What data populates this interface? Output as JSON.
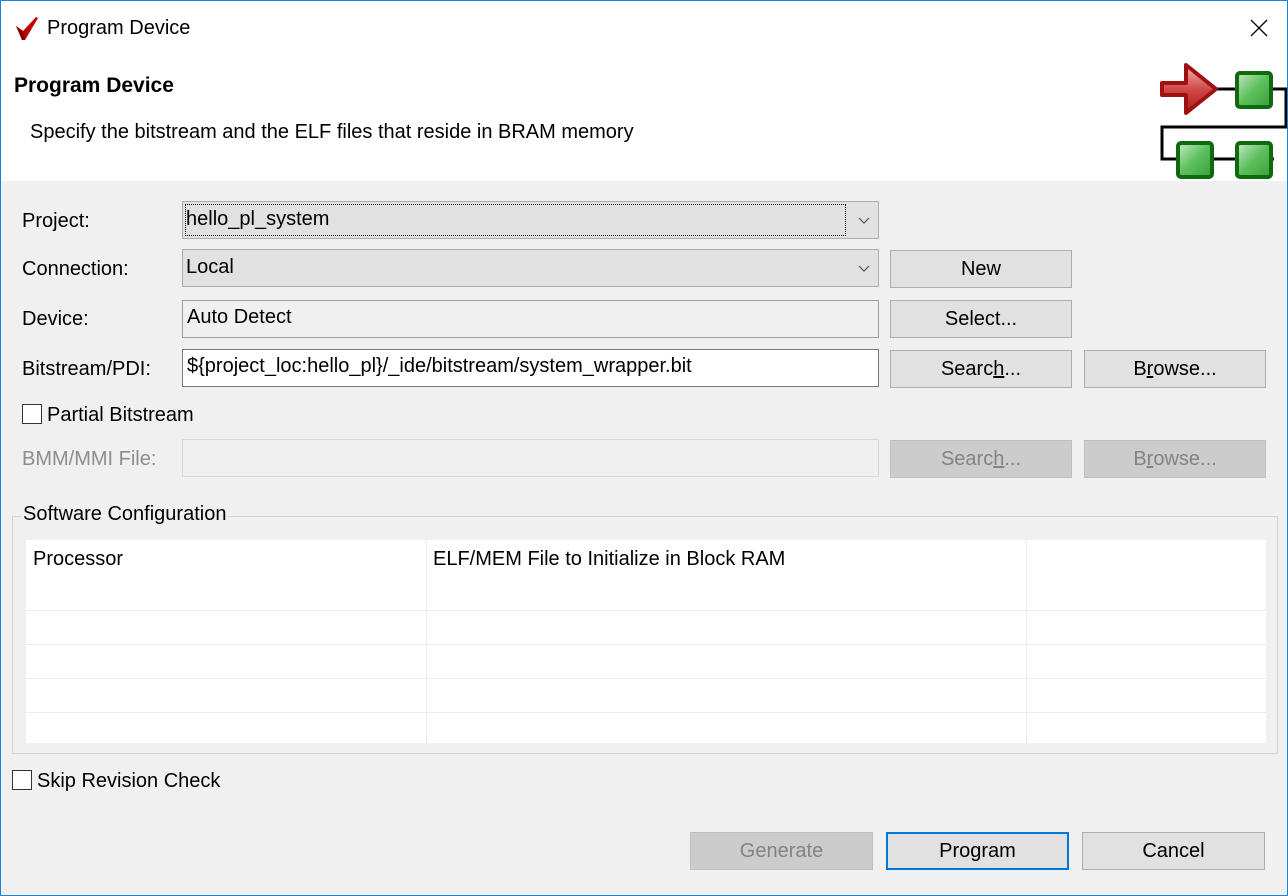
{
  "window": {
    "title": "Program Device"
  },
  "banner": {
    "title": "Program Device",
    "description": "Specify the bitstream and the ELF files that reside in BRAM memory"
  },
  "form": {
    "project": {
      "label": "Project:",
      "value": "hello_pl_system"
    },
    "connection": {
      "label": "Connection:",
      "value": "Local",
      "new_button": "New"
    },
    "device": {
      "label": "Device:",
      "value": "Auto Detect",
      "select_button": "Select..."
    },
    "bitstream": {
      "label": "Bitstream/PDI:",
      "value": "${project_loc:hello_pl}/_ide/bitstream/system_wrapper.bit",
      "search_button": {
        "pre": "Searc",
        "mnemonic": "h",
        "post": "..."
      },
      "browse_button": {
        "pre": "B",
        "mnemonic": "r",
        "post": "owse..."
      }
    },
    "partial_bitstream": {
      "label": "Partial Bitstream",
      "checked": false
    },
    "bmm": {
      "label": "BMM/MMI File:",
      "value": "",
      "enabled": false,
      "search_button": {
        "pre": "Searc",
        "mnemonic": "h",
        "post": "..."
      },
      "browse_button": {
        "pre": "B",
        "mnemonic": "r",
        "post": "owse..."
      }
    }
  },
  "software_config": {
    "legend": "Software Configuration",
    "columns": [
      "Processor",
      "ELF/MEM File to Initialize in Block RAM",
      ""
    ],
    "rows": []
  },
  "skip_revision_check": {
    "label": "Skip Revision Check",
    "checked": false
  },
  "footer": {
    "generate": "Generate",
    "program": "Program",
    "cancel": "Cancel"
  },
  "colors": {
    "accent": "#0078d7",
    "window_border": "#1883d7",
    "dialog_bg": "#f0f0f0",
    "logo_red": "#c00000",
    "graphic_green": "#1f8a1f"
  }
}
